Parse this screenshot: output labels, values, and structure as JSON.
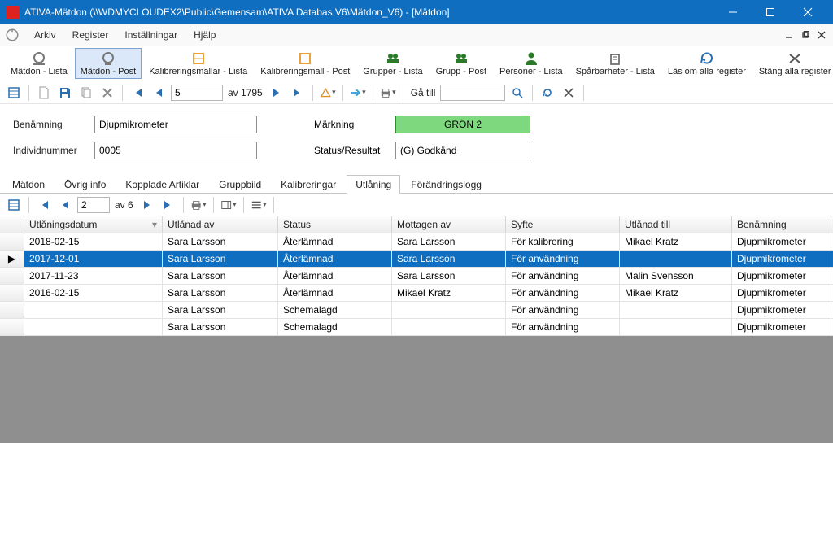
{
  "window": {
    "title": "ATIVA-Mätdon (\\\\WDMYCLOUDEX2\\Public\\Gemensam\\ATIVA Databas V6\\Mätdon_V6) - [Mätdon]"
  },
  "menu": {
    "arkiv": "Arkiv",
    "register": "Register",
    "installningar": "Inställningar",
    "hjalp": "Hjälp"
  },
  "tb1": {
    "matdon_lista": "Mätdon - Lista",
    "matdon_post": "Mätdon - Post",
    "kalibmallar_lista": "Kalibreringsmallar - Lista",
    "kalibmall_post": "Kalibreringsmall - Post",
    "grupper_lista": "Grupper - Lista",
    "grupp_post": "Grupp - Post",
    "personer_lista": "Personer - Lista",
    "sparbarheter_lista": "Spårbarheter - Lista",
    "las_om": "Läs om alla register",
    "stang_alla": "Stäng alla register"
  },
  "nav": {
    "pos": "5",
    "of_label": "av 1795",
    "go_to": "Gå till"
  },
  "form": {
    "benamning_label": "Benämning",
    "benamning_value": "Djupmikrometer",
    "individ_label": "Individnummer",
    "individ_value": "0005",
    "markning_label": "Märkning",
    "markning_value": "GRÖN 2",
    "status_label": "Status/Resultat",
    "status_value": "(G) Godkänd"
  },
  "tabs": {
    "t0": "Mätdon",
    "t1": "Övrig info",
    "t2": "Kopplade Artiklar",
    "t3": "Gruppbild",
    "t4": "Kalibreringar",
    "t5": "Utlåning",
    "t6": "Förändringslogg"
  },
  "subnav": {
    "pos": "2",
    "of_label": "av 6"
  },
  "grid": {
    "h0": "Utlåningsdatum",
    "h1": "Utlånad av",
    "h2": "Status",
    "h3": "Mottagen av",
    "h4": "Syfte",
    "h5": "Utlånad till",
    "h6": "Benämning",
    "rows": [
      {
        "d": "2018-02-15",
        "ua": "Sara Larsson",
        "st": "Återlämnad",
        "ma": "Sara Larsson",
        "sy": "För kalibrering",
        "ut": "Mikael Kratz",
        "bn": "Djupmikrometer"
      },
      {
        "d": "2017-12-01",
        "ua": "Sara Larsson",
        "st": "Återlämnad",
        "ma": "Sara Larsson",
        "sy": "För användning",
        "ut": "",
        "bn": "Djupmikrometer",
        "sel": true
      },
      {
        "d": "2017-11-23",
        "ua": "Sara Larsson",
        "st": "Återlämnad",
        "ma": "Sara Larsson",
        "sy": "För användning",
        "ut": "Malin Svensson",
        "bn": "Djupmikrometer"
      },
      {
        "d": "2016-02-15",
        "ua": "Sara Larsson",
        "st": "Återlämnad",
        "ma": "Mikael Kratz",
        "sy": "För användning",
        "ut": "Mikael Kratz",
        "bn": "Djupmikrometer"
      },
      {
        "d": "",
        "ua": "Sara Larsson",
        "st": "Schemalagd",
        "ma": "",
        "sy": "För användning",
        "ut": "",
        "bn": "Djupmikrometer"
      },
      {
        "d": "",
        "ua": "Sara Larsson",
        "st": "Schemalagd",
        "ma": "",
        "sy": "För användning",
        "ut": "",
        "bn": "Djupmikrometer"
      }
    ]
  }
}
